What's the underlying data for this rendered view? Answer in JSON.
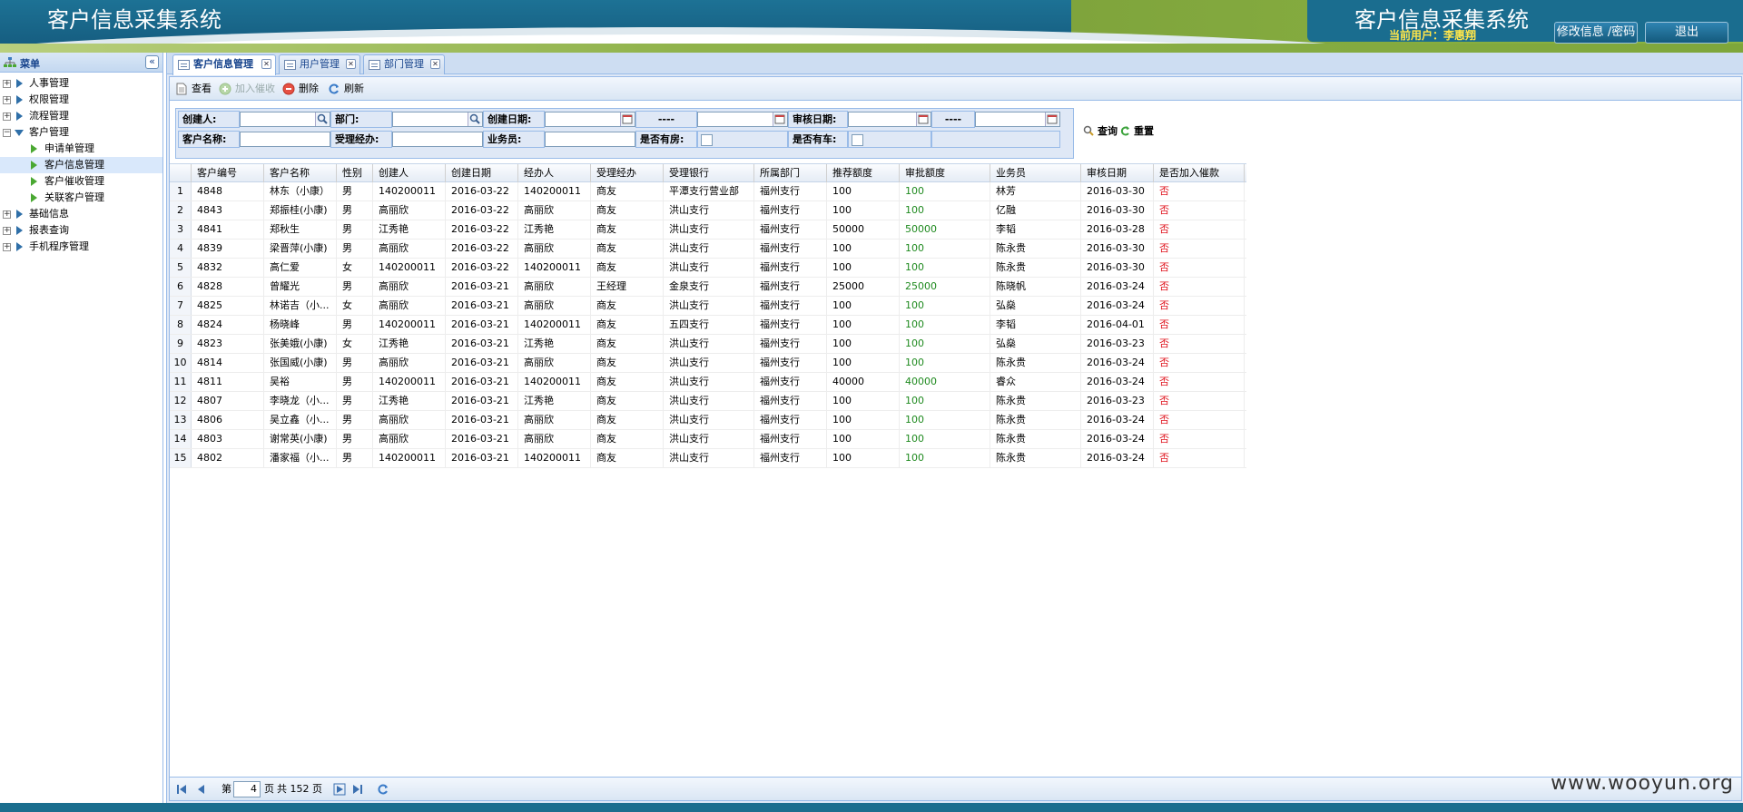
{
  "header": {
    "title_left": "客户信息采集系统",
    "title_right": "客户信息采集系统",
    "current_user_label": "当前用户：李惠翔",
    "modify_button": "修改信息 /密码",
    "logout_button": "退出"
  },
  "sidebar": {
    "title": "菜单",
    "items": [
      {
        "label": "人事管理",
        "level": 0,
        "expanded": false
      },
      {
        "label": "权限管理",
        "level": 0,
        "expanded": false
      },
      {
        "label": "流程管理",
        "level": 0,
        "expanded": false
      },
      {
        "label": "客户管理",
        "level": 0,
        "expanded": true
      },
      {
        "label": "申请单管理",
        "level": 1
      },
      {
        "label": "客户信息管理",
        "level": 1,
        "selected": true
      },
      {
        "label": "客户催收管理",
        "level": 1
      },
      {
        "label": "关联客户管理",
        "level": 1
      },
      {
        "label": "基础信息",
        "level": 0,
        "expanded": false
      },
      {
        "label": "报表查询",
        "level": 0,
        "expanded": false
      },
      {
        "label": "手机程序管理",
        "level": 0,
        "expanded": false
      }
    ]
  },
  "tabs": [
    {
      "label": "客户信息管理",
      "active": true
    },
    {
      "label": "用户管理",
      "active": false
    },
    {
      "label": "部门管理",
      "active": false
    }
  ],
  "toolbar": {
    "view": "查看",
    "add_collection": "加入催收",
    "delete": "删除",
    "refresh": "刷新"
  },
  "filter": {
    "creator": "创建人:",
    "department": "部门:",
    "create_date": "创建日期:",
    "range_sep": "----",
    "review_date": "审核日期:",
    "range_sep2": "----",
    "customer_name": "客户名称:",
    "handler": "受理经办:",
    "salesman": "业务员:",
    "has_house": "是否有房:",
    "has_car": "是否有车:",
    "search": "查询",
    "reset": "重置"
  },
  "grid": {
    "columns": [
      "客户编号",
      "客户名称",
      "性别",
      "创建人",
      "创建日期",
      "经办人",
      "受理经办",
      "受理银行",
      "所属部门",
      "推荐额度",
      "审批额度",
      "业务员",
      "审核日期",
      "是否加入催款"
    ],
    "rows": [
      [
        "1",
        "4848",
        "林东（小康）",
        "男",
        "140200011",
        "2016-03-22",
        "140200011",
        "商友",
        "平潭支行营业部",
        "福州支行",
        "100",
        "100",
        "林芳",
        "2016-03-30",
        "否"
      ],
      [
        "2",
        "4843",
        "郑振桂(小康)",
        "男",
        "高丽欣",
        "2016-03-22",
        "高丽欣",
        "商友",
        "洪山支行",
        "福州支行",
        "100",
        "100",
        "亿融",
        "2016-03-30",
        "否"
      ],
      [
        "3",
        "4841",
        "郑秋生",
        "男",
        "江秀艳",
        "2016-03-22",
        "江秀艳",
        "商友",
        "洪山支行",
        "福州支行",
        "50000",
        "50000",
        "李韬",
        "2016-03-28",
        "否"
      ],
      [
        "4",
        "4839",
        "梁晋萍(小康)",
        "男",
        "高丽欣",
        "2016-03-22",
        "高丽欣",
        "商友",
        "洪山支行",
        "福州支行",
        "100",
        "100",
        "陈永贵",
        "2016-03-30",
        "否"
      ],
      [
        "5",
        "4832",
        "高仁爱",
        "女",
        "140200011",
        "2016-03-22",
        "140200011",
        "商友",
        "洪山支行",
        "福州支行",
        "100",
        "100",
        "陈永贵",
        "2016-03-30",
        "否"
      ],
      [
        "6",
        "4828",
        "曾耀光",
        "男",
        "高丽欣",
        "2016-03-21",
        "高丽欣",
        "王经理",
        "金泉支行",
        "福州支行",
        "25000",
        "25000",
        "陈晓帆",
        "2016-03-24",
        "否"
      ],
      [
        "7",
        "4825",
        "林诺吉（小...",
        "女",
        "高丽欣",
        "2016-03-21",
        "高丽欣",
        "商友",
        "洪山支行",
        "福州支行",
        "100",
        "100",
        "弘燊",
        "2016-03-24",
        "否"
      ],
      [
        "8",
        "4824",
        "杨晓峰",
        "男",
        "140200011",
        "2016-03-21",
        "140200011",
        "商友",
        "五四支行",
        "福州支行",
        "100",
        "100",
        "李韬",
        "2016-04-01",
        "否"
      ],
      [
        "9",
        "4823",
        "张美娥(小康)",
        "女",
        "江秀艳",
        "2016-03-21",
        "江秀艳",
        "商友",
        "洪山支行",
        "福州支行",
        "100",
        "100",
        "弘燊",
        "2016-03-23",
        "否"
      ],
      [
        "10",
        "4814",
        "张国威(小康)",
        "男",
        "高丽欣",
        "2016-03-21",
        "高丽欣",
        "商友",
        "洪山支行",
        "福州支行",
        "100",
        "100",
        "陈永贵",
        "2016-03-24",
        "否"
      ],
      [
        "11",
        "4811",
        "吴裕",
        "男",
        "140200011",
        "2016-03-21",
        "140200011",
        "商友",
        "洪山支行",
        "福州支行",
        "40000",
        "40000",
        "睿众",
        "2016-03-24",
        "否"
      ],
      [
        "12",
        "4807",
        "李晓龙（小...",
        "男",
        "江秀艳",
        "2016-03-21",
        "江秀艳",
        "商友",
        "洪山支行",
        "福州支行",
        "100",
        "100",
        "陈永贵",
        "2016-03-23",
        "否"
      ],
      [
        "13",
        "4806",
        "吴立鑫（小...",
        "男",
        "高丽欣",
        "2016-03-21",
        "高丽欣",
        "商友",
        "洪山支行",
        "福州支行",
        "100",
        "100",
        "陈永贵",
        "2016-03-24",
        "否"
      ],
      [
        "14",
        "4803",
        "谢常英(小康)",
        "男",
        "高丽欣",
        "2016-03-21",
        "高丽欣",
        "商友",
        "洪山支行",
        "福州支行",
        "100",
        "100",
        "陈永贵",
        "2016-03-24",
        "否"
      ],
      [
        "15",
        "4802",
        "潘家福（小...",
        "男",
        "140200011",
        "2016-03-21",
        "140200011",
        "商友",
        "洪山支行",
        "福州支行",
        "100",
        "100",
        "陈永贵",
        "2016-03-24",
        "否"
      ]
    ]
  },
  "pager": {
    "page_prefix": "第",
    "current_page": "4",
    "page_suffix": "页",
    "total_label": "共 152 页"
  },
  "watermark": "www.wooyun.org",
  "colors": {
    "header_blue": "#1b6e8e",
    "header_green": "#8cb544",
    "user_yellow": "#ffe64a",
    "approve_green": "#1f8a1f",
    "no_red": "#e0141e"
  }
}
